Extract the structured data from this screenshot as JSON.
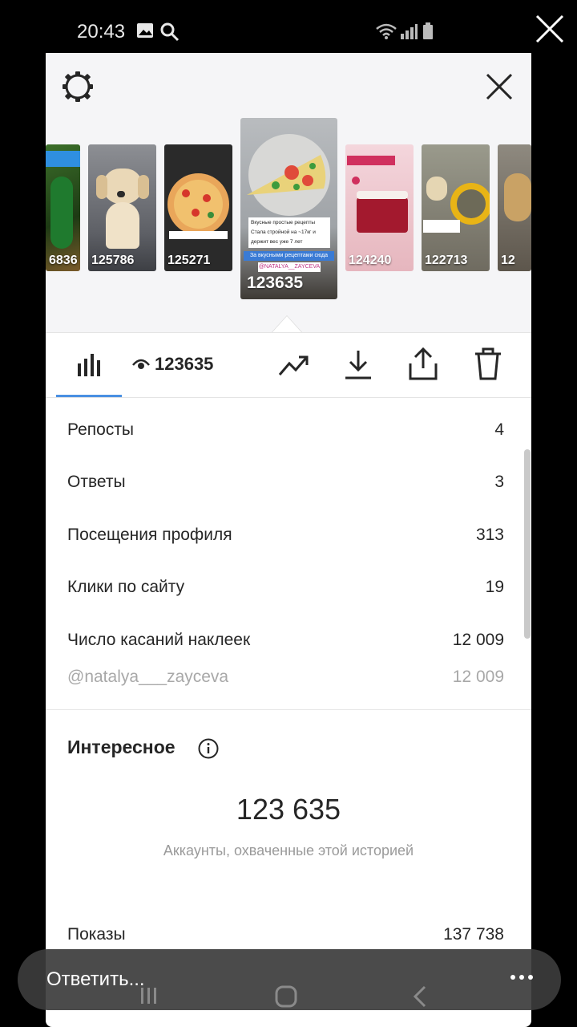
{
  "status_bar": {
    "time": "20:43"
  },
  "story_strip": {
    "thumbs": [
      {
        "views": "6836"
      },
      {
        "views": "125786"
      },
      {
        "views": "125271"
      },
      {
        "views": "123635"
      },
      {
        "views": "124240"
      },
      {
        "views": "122713"
      },
      {
        "views": "12"
      }
    ],
    "selected": {
      "overlay_lines": [
        "Вкусные простые рецепты",
        "Стала стройной на ~17кг и",
        "держит вес уже 7 лет"
      ],
      "tag": "За вкусными рецептами сюда",
      "handle": "@NATALYA__ZAYCEVA"
    }
  },
  "toolbar": {
    "views": "123635"
  },
  "stats": [
    {
      "label": "Репосты",
      "value": "4"
    },
    {
      "label": "Ответы",
      "value": "3"
    },
    {
      "label": "Посещения профиля",
      "value": "313"
    },
    {
      "label": "Клики по сайту",
      "value": "19"
    },
    {
      "label": "Число касаний наклеек",
      "value": "12 009"
    },
    {
      "label": "@natalya___zayceva",
      "value": "12 009"
    }
  ],
  "discovery": {
    "title": "Интересное",
    "reach": "123 635",
    "reach_caption": "Аккаунты, охваченные этой историей",
    "impressions_label": "Показы",
    "impressions_value": "137 738"
  },
  "reply": {
    "placeholder": "Ответить..."
  }
}
